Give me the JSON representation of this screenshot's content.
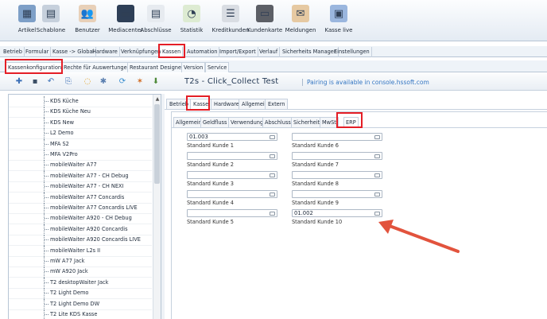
{
  "toolbar": {
    "items": [
      {
        "label": "Artikel",
        "icon": "box-icon",
        "symbol": "▦",
        "color": "#7d9fc7"
      },
      {
        "label": "Schablone",
        "icon": "template-icon",
        "symbol": "▤",
        "color": "#c6d0dc"
      },
      {
        "label": "Benutzer",
        "icon": "users-icon",
        "symbol": "👥",
        "color": "#e8d0b8"
      },
      {
        "label": "Mediacenter",
        "icon": "monitor-icon",
        "symbol": "▬",
        "color": "#2e3f57"
      },
      {
        "label": "Abschlüsse",
        "icon": "document-icon",
        "symbol": "▤",
        "color": "#e7ebf0"
      },
      {
        "label": "Statistik",
        "icon": "statistics-icon",
        "symbol": "◔",
        "color": "#ddebd2"
      },
      {
        "label": "Kreditkunden",
        "icon": "credit-customer-icon",
        "symbol": "☰",
        "color": "#d9dde3"
      },
      {
        "label": "Kundenkarte",
        "icon": "customer-card-icon",
        "symbol": "▭",
        "color": "#5c5f66"
      },
      {
        "label": "Meldungen",
        "icon": "messages-icon",
        "symbol": "✉",
        "color": "#e6c9a2"
      },
      {
        "label": "Kasse live",
        "icon": "register-live-icon",
        "symbol": "▣",
        "color": "#9ab6de"
      }
    ]
  },
  "menu1": {
    "tabs": [
      "Betrieb",
      "Formular",
      "Kasse -> Global",
      "Hardware",
      "Verknüpfungen",
      "Kassen",
      "Automation",
      "Import/Export",
      "Verlauf",
      "Sicherheits Manager",
      "Einstellungen"
    ],
    "active": "Kassen"
  },
  "menu2": {
    "tabs": [
      "Kassenkonfiguration",
      "Rechte für Auswertungen",
      "Restaurant Designer",
      "Version",
      "Service"
    ],
    "active": "Kassenkonfiguration"
  },
  "subtoolbar": {
    "icons": [
      "add-icon",
      "save-icon",
      "undo-icon",
      "copy-icon",
      "comment-icon",
      "settings-icon",
      "sync-icon",
      "star-gear-icon",
      "download-icon"
    ],
    "title": "T2s - Click_Collect Test",
    "pairing_text": "Pairing is available in console.hssoft.com"
  },
  "left_list": {
    "items": [
      "KDS Küche",
      "KDS Küche Neu",
      "KDS New",
      "L2 Demo",
      "MFA S2",
      "MFA V2Pro",
      "mobileWaiter A77",
      "mobileWaiter A77 - CH Debug",
      "mobileWaiter A77 - CH NEXI",
      "mobileWaiter A77 Concardis",
      "mobileWaiter A77 Concardis LIVE",
      "mobileWaiter A920 - CH Debug",
      "mobileWaiter A920 Concardis",
      "mobileWaiter A920 Concardis LIVE",
      "mobileWaiter L2s II",
      "mW A77 Jack",
      "mW A920 Jack",
      "T2 desktopWaiter Jack",
      "T2 Light Demo",
      "T2 Light Demo DW",
      "T2 Lite KDS Kasse"
    ]
  },
  "tabs_level1": {
    "tabs": [
      "Betrieb",
      "Kasse",
      "Hardware",
      "Allgemein",
      "Extern"
    ],
    "active": "Kasse"
  },
  "tabs_level2": {
    "tabs": [
      "Allgemein",
      "Geldfluss",
      "Verwendung",
      "Abschluss",
      "Sicherheit",
      "MwSt",
      "ERP"
    ],
    "active": "ERP"
  },
  "erp": {
    "fields": [
      {
        "label": "Standard Kunde 1",
        "value": "01.003"
      },
      {
        "label": "Standard Kunde 2",
        "value": ""
      },
      {
        "label": "Standard Kunde 3",
        "value": ""
      },
      {
        "label": "Standard Kunde 4",
        "value": ""
      },
      {
        "label": "Standard Kunde 5",
        "value": ""
      },
      {
        "label": "Standard Kunde 6",
        "value": ""
      },
      {
        "label": "Standard Kunde 7",
        "value": ""
      },
      {
        "label": "Standard Kunde 8",
        "value": ""
      },
      {
        "label": "Standard Kunde 9",
        "value": ""
      },
      {
        "label": "Standard Kunde 10",
        "value": "01.002"
      }
    ]
  },
  "colors": {
    "highlight": "#e41e26",
    "arrow": "#e2533d",
    "link": "#3476c2"
  }
}
